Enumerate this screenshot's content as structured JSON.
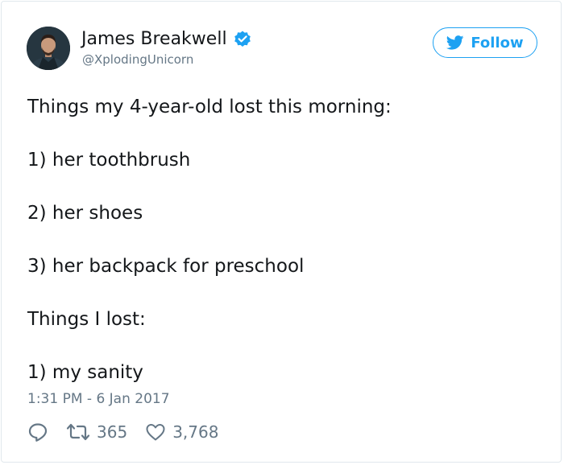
{
  "author": {
    "name": "James Breakwell",
    "handle": "@XplodingUnicorn",
    "verified": true,
    "verified_color": "#1da1f2"
  },
  "follow_button": {
    "label": "Follow",
    "icon": "twitter-bird-icon",
    "color": "#1da1f2"
  },
  "tweet": {
    "lines": [
      "Things my 4-year-old lost this morning:",
      "1) her toothbrush",
      "2) her shoes",
      "3) her backpack for preschool",
      "Things I lost:",
      "1) my sanity"
    ],
    "timestamp": "1:31 PM - 6 Jan 2017"
  },
  "actions": {
    "reply_icon": "reply-icon",
    "retweet_icon": "retweet-icon",
    "retweet_count": "365",
    "like_icon": "heart-icon",
    "like_count": "3,768"
  }
}
